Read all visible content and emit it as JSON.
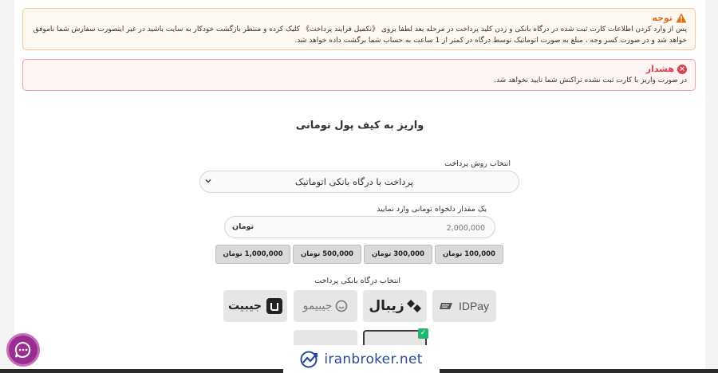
{
  "alerts": {
    "warning": {
      "title": "توجه",
      "line1": "پس از وارد کردن اطلاعات کارت ثبت شده در درگاه بانکی و زدن کلید پرداخت در مرحله بعد لطفا بروی 《تکمیل فرایند پرداخت》 کلیک کرده و منتظر بازگشت خودکار به سایت باشید در غیر اینصورت سفارش شما ناموفق",
      "line2": "خواهد شد و در صورت کسر وجه ، مبلغ به صورت اتوماتیک توسط درگاه در کمتر از 1 ساعت به حساب شما برگشت داده خواهد شد."
    },
    "danger": {
      "title": "هشدار",
      "body": "در صورت واریز با کارت ثبت نشده تراکنش شما تایید نخواهد شد."
    }
  },
  "form": {
    "heading": "واریز به کیف پول تومانی",
    "method_label": "انتخاب روش پرداخت",
    "method_value": "پرداخت با درگاه بانکی اتوماتیک",
    "amount_label": "یک مقدار دلخواه تومانی وارد نمایید",
    "amount_placeholder": "2,000,000",
    "currency": "تومان",
    "presets": [
      "100,000 تومان",
      "300,000 تومان",
      "500,000 تومان",
      "1,000,000 تومان"
    ],
    "gateway_label": "انتخاب درگاه بانکی پرداخت",
    "gateways": [
      {
        "name": "IDPay",
        "icon": "idpay-logo"
      },
      {
        "name": "زیبال",
        "icon": "zibal-logo"
      },
      {
        "name": "جیبیمو",
        "icon": "jibimo-logo"
      },
      {
        "name": "جیبیت",
        "icon": "jibit-logo"
      }
    ]
  },
  "watermark": "iranbroker.net",
  "colors": {
    "warning": "#e0701a",
    "danger": "#d9434c",
    "chat": "#9b2d8f",
    "selected_check": "#22b573",
    "brand": "#2a4a9e"
  }
}
